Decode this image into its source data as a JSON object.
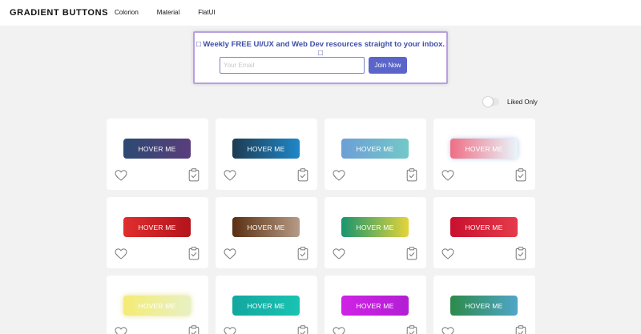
{
  "header": {
    "brand": "GRADIENT BUTTONS",
    "nav": [
      "Colorion",
      "Material",
      "FlatUI"
    ]
  },
  "newsletter": {
    "title": "Weekly FREE UI/UX and Web Dev resources straight to your inbox.",
    "email_placeholder": "Your Email",
    "join_label": "Join Now",
    "title_color": "#3f4da8",
    "button_color": "#5a64c9"
  },
  "filter": {
    "liked_only_label": "Liked Only",
    "liked_only_on": false
  },
  "cards": [
    {
      "label": "HOVER ME",
      "gradient": [
        "#2c4a72",
        "#5a3d7c"
      ],
      "shadow": "none"
    },
    {
      "label": "HOVER ME",
      "gradient": [
        "#1e3c52",
        "#1f87c9"
      ],
      "shadow": "none"
    },
    {
      "label": "HOVER ME",
      "gradient": [
        "#6d9fd6",
        "#72c8c8"
      ],
      "shadow": "none"
    },
    {
      "label": "HOVER ME",
      "gradient": [
        "#ef6e85",
        "#e8f6fb"
      ],
      "shadow": "0 0 6px rgba(150,180,220,0.7)"
    },
    {
      "label": "HOVER ME",
      "gradient": [
        "#e02e2e",
        "#b3141c"
      ],
      "shadow": "none"
    },
    {
      "label": "HOVER ME",
      "gradient": [
        "#5a2f12",
        "#b69b86"
      ],
      "shadow": "none"
    },
    {
      "label": "HOVER ME",
      "gradient": [
        "#17956f",
        "#e4d43a"
      ],
      "shadow": "none"
    },
    {
      "label": "HOVER ME",
      "gradient": [
        "#c8102e",
        "#e53b4c"
      ],
      "shadow": "none"
    },
    {
      "label": "HOVER ME",
      "gradient": [
        "#f4ec74",
        "#e8f0c4"
      ],
      "shadow": "0 0 7px rgba(225,215,110,0.75)"
    },
    {
      "label": "HOVER ME",
      "gradient": [
        "#12a7a0",
        "#19c3b2"
      ],
      "shadow": "none"
    },
    {
      "label": "HOVER ME",
      "gradient": [
        "#cf22e6",
        "#b31fd3"
      ],
      "shadow": "none"
    },
    {
      "label": "HOVER ME",
      "gradient": [
        "#2c8a4a",
        "#50a6c8"
      ],
      "shadow": "none"
    }
  ],
  "icons": {
    "newsletter_left": "envelope-icon",
    "newsletter_right": "envelope-icon",
    "card_like": "heart-icon",
    "card_copy": "clipboard-check-icon"
  }
}
